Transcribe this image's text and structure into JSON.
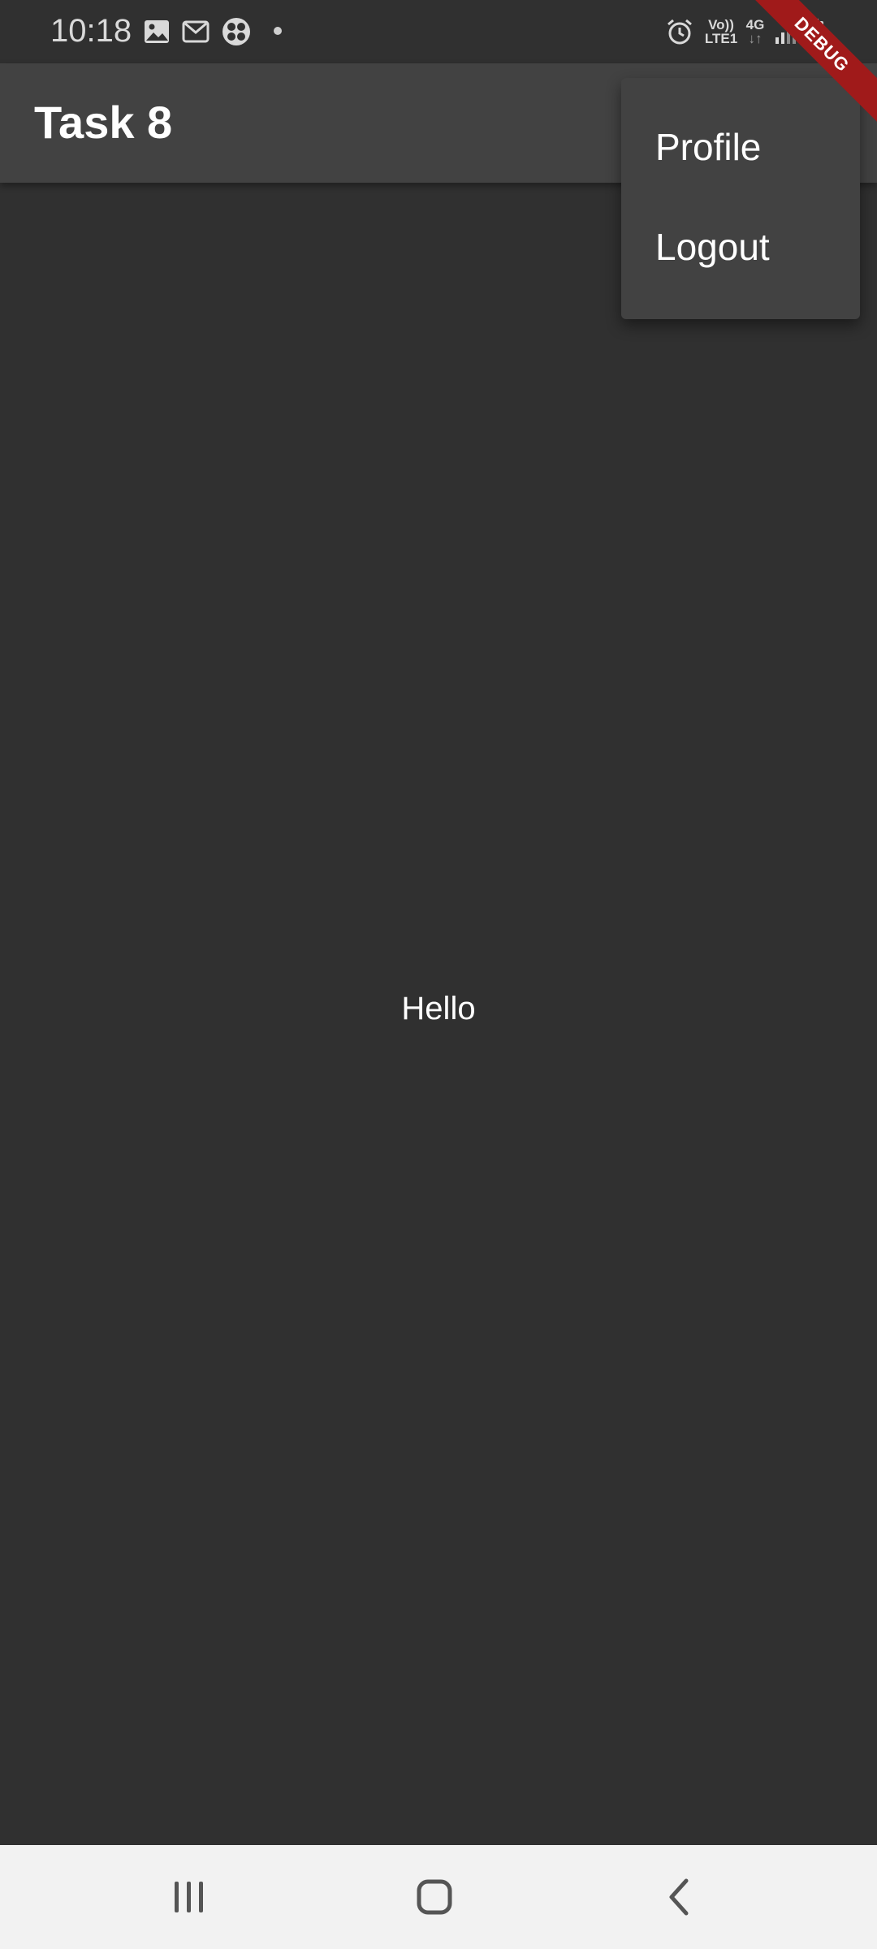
{
  "status_bar": {
    "time": "10:18",
    "volte_top": "Vo))",
    "volte_bottom": "LTE1",
    "network_top": "4G",
    "network_bottom": "↓↑",
    "icons": [
      "image-icon",
      "gmail-icon",
      "fan-icon",
      "notification-dot-icon",
      "alarm-icon",
      "volte-icon",
      "4g-icon",
      "signal-icon",
      "battery-icon"
    ]
  },
  "debug_banner": {
    "label": "DEBUG"
  },
  "app_bar": {
    "title": "Task 8"
  },
  "popup_menu": {
    "items": [
      {
        "label": "Profile"
      },
      {
        "label": "Logout"
      }
    ]
  },
  "body": {
    "text": "Hello"
  },
  "nav_bar": {
    "icons": [
      "recent-apps-icon",
      "home-icon",
      "back-icon"
    ]
  },
  "colors": {
    "background": "#303030",
    "app_bar": "#424242",
    "menu": "#424242",
    "debug_banner": "#a01a1a",
    "nav_bar": "#f2f2f2",
    "text": "#ffffff"
  }
}
